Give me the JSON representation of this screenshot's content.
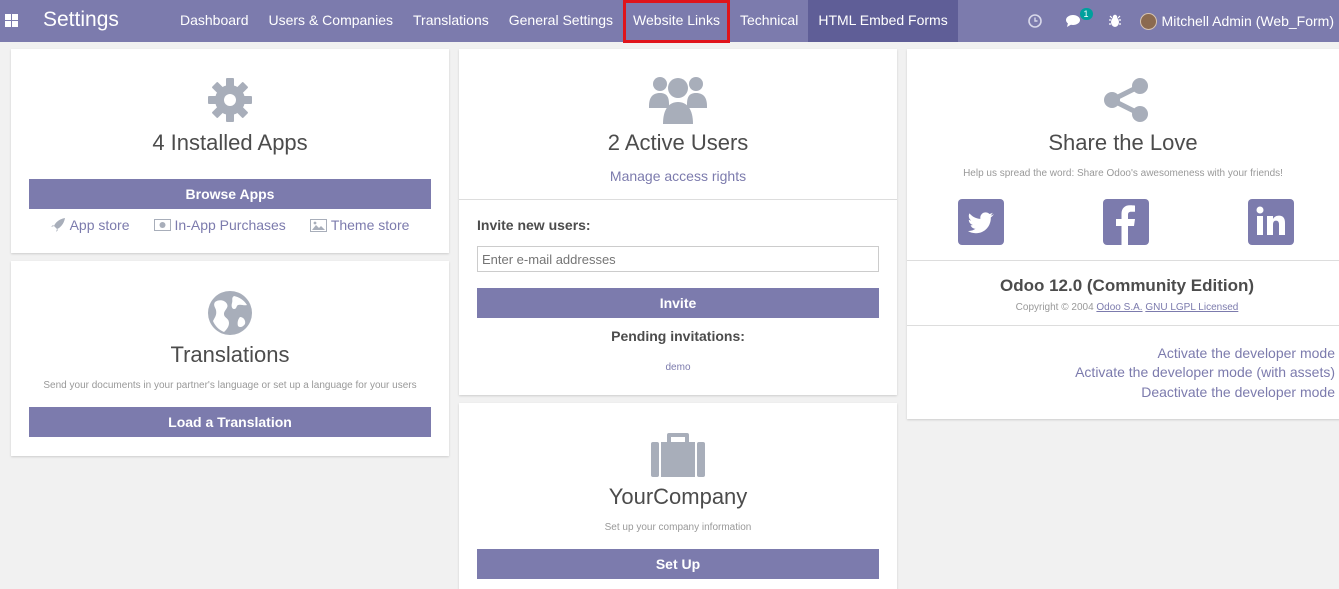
{
  "navbar": {
    "title": "Settings",
    "menu": [
      "Dashboard",
      "Users & Companies",
      "Translations",
      "General Settings",
      "Website Links",
      "Technical",
      "HTML Embed Forms"
    ],
    "message_count": "1",
    "user": "Mitchell Admin (Web_Form)"
  },
  "apps": {
    "title": "4 Installed Apps",
    "browse": "Browse Apps",
    "app_store": "App store",
    "in_app": "In-App Purchases",
    "theme_store": "Theme store"
  },
  "translations": {
    "title": "Translations",
    "desc": "Send your documents in your partner's language or set up a language for your users",
    "button": "Load a Translation"
  },
  "users": {
    "title": "2 Active Users",
    "manage": "Manage access rights",
    "invite_label": "Invite new users:",
    "email_placeholder": "Enter e-mail addresses",
    "invite_button": "Invite",
    "pending_label": "Pending invitations:",
    "pending_user": "demo"
  },
  "company": {
    "title": "YourCompany",
    "desc": "Set up your company information",
    "button": "Set Up"
  },
  "share": {
    "title": "Share the Love",
    "desc": "Help us spread the word: Share Odoo's awesomeness with your friends!"
  },
  "version": {
    "title": "Odoo 12.0 (Community Edition)",
    "copyright": "Copyright © 2004",
    "company_link": "Odoo S.A.",
    "license_link": "GNU LGPL Licensed"
  },
  "developer": {
    "activate": "Activate the developer mode",
    "activate_assets": "Activate the developer mode (with assets)",
    "deactivate": "Deactivate the developer mode"
  },
  "colors": {
    "brand": "#7c7bad",
    "highlight": "#e0141b",
    "icon_gray": "#a8aeba"
  }
}
